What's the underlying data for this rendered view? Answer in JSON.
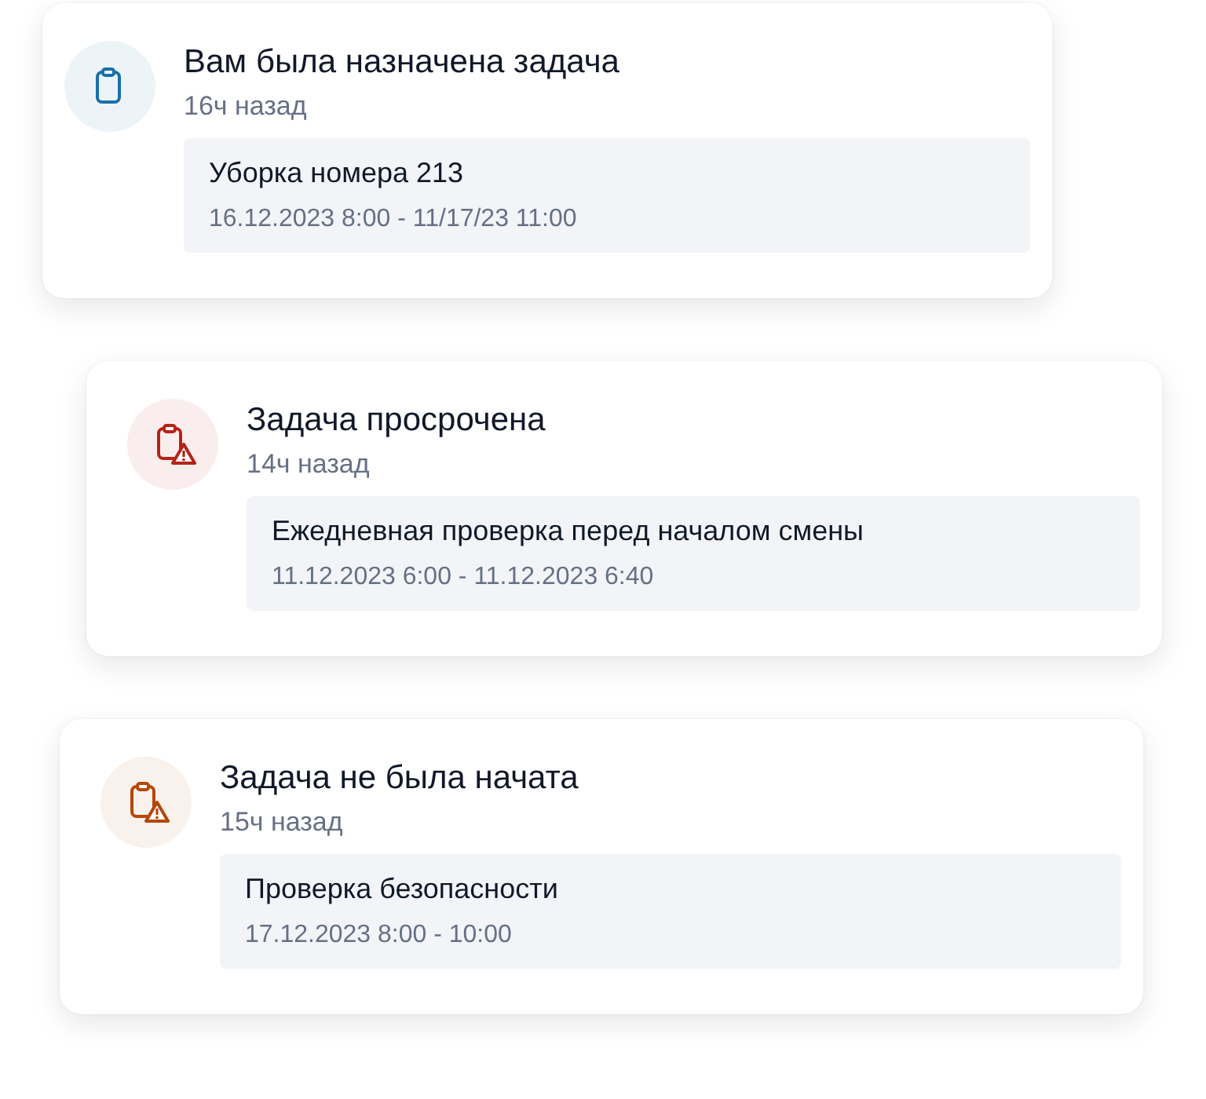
{
  "notifications": [
    {
      "kind": "assigned",
      "color": "#1a6fa8",
      "title": "Вам была назначена задача",
      "time": "16ч назад",
      "task": "Уборка номера 213",
      "period": "16.12.2023 8:00 - 11/17/23 11:00"
    },
    {
      "kind": "warning",
      "color": "#b42318",
      "title": "Задача просрочена",
      "time": "14ч назад",
      "task": "Ежедневная проверка перед началом смены",
      "period": "11.12.2023 6:00 - 11.12.2023 6:40"
    },
    {
      "kind": "warning",
      "color": "#b54708",
      "title": "Задача не была начата",
      "time": "15ч назад",
      "task": "Проверка безопасности",
      "period": "17.12.2023 8:00 - 10:00"
    }
  ]
}
